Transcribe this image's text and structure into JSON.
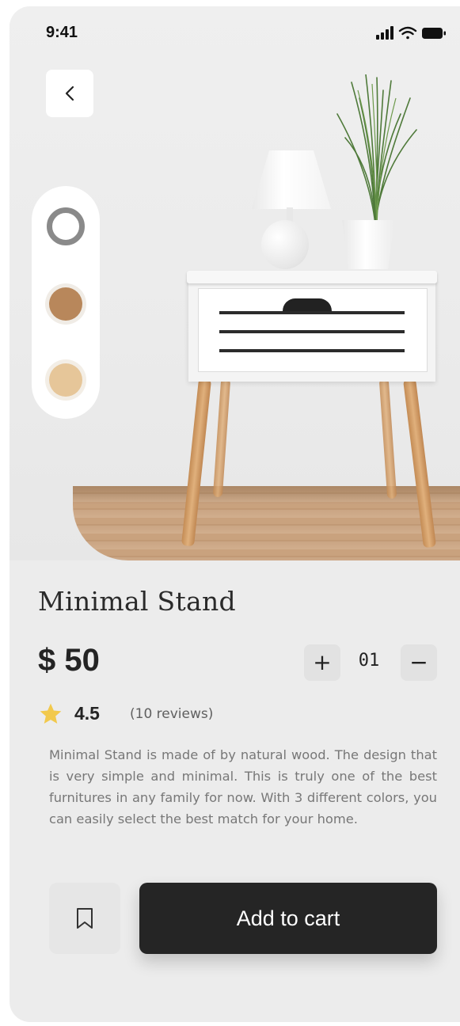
{
  "status_bar": {
    "time": "9:41",
    "icons": [
      "signal-icon",
      "wifi-icon",
      "battery-icon"
    ]
  },
  "header": {
    "back_icon": "chevron-left-icon"
  },
  "color_options": {
    "swatches": [
      {
        "name": "gray",
        "color": "#8a8a8a",
        "selected": true
      },
      {
        "name": "brown",
        "color": "#b8875b",
        "selected": false
      },
      {
        "name": "beige",
        "color": "#e6c699",
        "selected": false
      }
    ]
  },
  "product": {
    "title": "Minimal Stand",
    "price": "$ 50",
    "quantity": "01",
    "increase_label": "+",
    "decrease_label": "−",
    "rating": "4.5",
    "reviews": "(10 reviews)",
    "description": "Minimal Stand is made of by natural wood. The design that is very simple and minimal. This is truly one of the best furnitures in any family for now. With 3 different colors, you can easily select the best match for your home."
  },
  "actions": {
    "bookmark_icon": "bookmark-icon",
    "add_to_cart_label": "Add to cart"
  },
  "colors": {
    "background": "#ececec",
    "primary_button": "#252525",
    "star": "#f2c94c"
  }
}
